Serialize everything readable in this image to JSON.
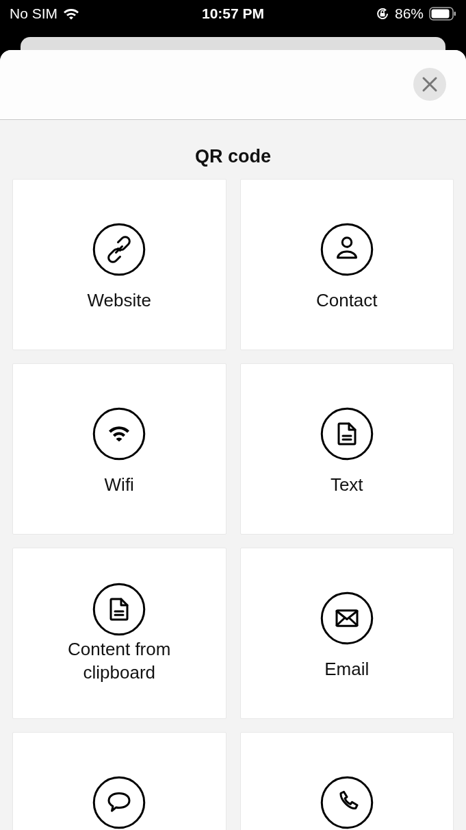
{
  "status_bar": {
    "carrier": "No SIM",
    "time": "10:57 PM",
    "battery": "86%"
  },
  "sheet": {
    "title": "QR code"
  },
  "options": [
    {
      "kind": "link",
      "label": "Website"
    },
    {
      "kind": "person",
      "label": "Contact"
    },
    {
      "kind": "wifi",
      "label": "Wifi"
    },
    {
      "kind": "document",
      "label": "Text"
    },
    {
      "kind": "document",
      "label": "Content from clipboard"
    },
    {
      "kind": "envelope",
      "label": "Email"
    },
    {
      "kind": "chat"
    },
    {
      "kind": "phone"
    }
  ]
}
